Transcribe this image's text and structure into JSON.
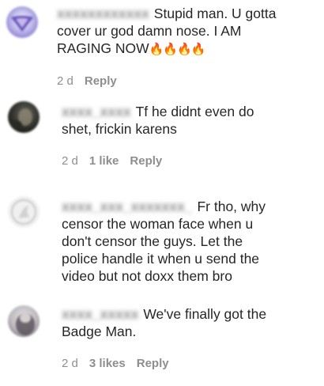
{
  "comments": [
    {
      "username": "xxxxxxxxxxxx",
      "line1": "Stupid man. U gotta",
      "line2": "cover ur god damn nose. I AM",
      "line3": "RAGING NOW",
      "emoji": "🔥🔥🔥🔥",
      "time": "2 d",
      "likes": "",
      "reply": "Reply"
    },
    {
      "username": "xxxx_xxxx",
      "line1": "Tf he didnt even do",
      "line2": "shet, frickin karens",
      "time": "2 d",
      "likes": "1 like",
      "reply": "Reply"
    },
    {
      "username": "xxxx_xxx_xxxxxxx_",
      "line1": "Fr tho, why",
      "line2": "censor the woman face when u",
      "line3": "don't censor the guys. Let the",
      "line4": "police handle it when u send the",
      "line5": "video but not doxx them bro"
    },
    {
      "username": "xxxx_xxxxx",
      "line1": "We've finally got the",
      "line2": "Badge Man.",
      "time": "2 d",
      "likes": "3 likes",
      "reply": "Reply"
    }
  ]
}
